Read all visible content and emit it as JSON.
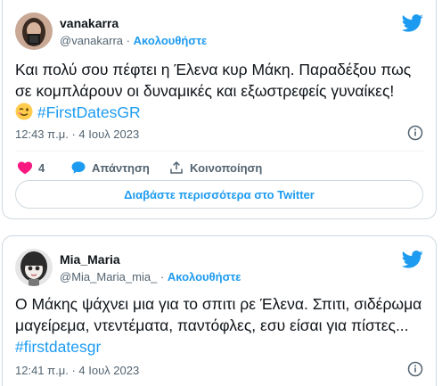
{
  "tweets": [
    {
      "display_name": "vanakarra",
      "handle": "@vanakarra",
      "separator": "·",
      "follow_label": "Ακολουθήστε",
      "text_main": "Και πολύ σου πέφτει η Έλενα κυρ Μάκη. Παραδέξου πως σε κομπλάρουν οι δυναμικές και εξωστρεφείς γυναίκες!",
      "emoji": "winking-face-emoji",
      "hashtag": "#FirstDatesGR",
      "timestamp": "12:43 π.μ. · 4 Ιουλ 2023",
      "likes": "4",
      "reply_label": "Απάντηση",
      "share_label": "Κοινοποίηση",
      "read_more_label": "Διαβάστε περισσότερα στο Twitter"
    },
    {
      "display_name": "Mia_Maria",
      "handle": "@Mia_Maria_mia_",
      "separator": "·",
      "follow_label": "Ακολουθήστε",
      "text_main": "Ο Μάκης ψάχνει μια για το σπιτι ρε Έλενα. Σπιτι, σιδέρωμα μαγείρεμα, ντεντέματα, παντόφλες, εσυ είσαι για πίστες...",
      "hashtag": "#firstdatesgr",
      "timestamp": "12:41 π.μ. · 4 Ιουλ 2023"
    }
  ],
  "colors": {
    "accent": "#1d9bf0",
    "like": "#f91880",
    "text": "#0f1419",
    "muted": "#536471",
    "border": "#cfd9de"
  },
  "icons": [
    "twitter-bird-icon",
    "info-icon",
    "heart-icon",
    "reply-bubble-icon",
    "share-icon"
  ]
}
